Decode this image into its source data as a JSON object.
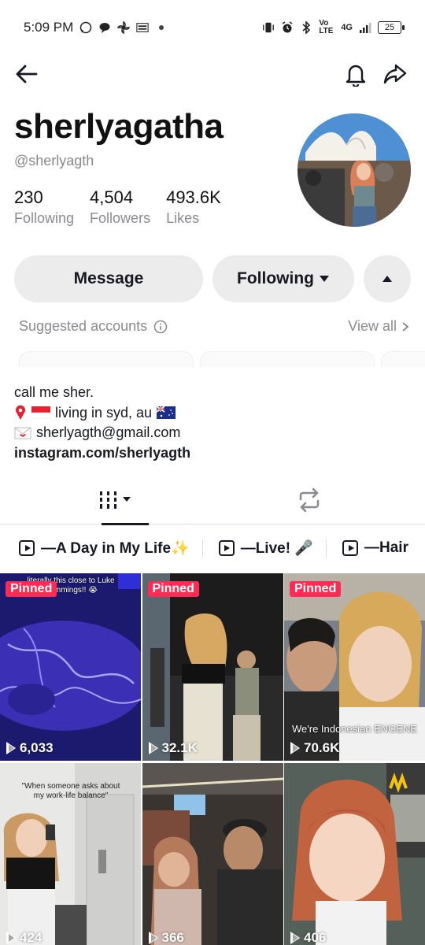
{
  "status_bar": {
    "time": "5:09 PM",
    "network": "Vo LTE",
    "signal": "4G",
    "battery": "25"
  },
  "profile": {
    "display_name": "sherlyagatha",
    "handle": "@sherlyagth",
    "stats": [
      {
        "value": "230",
        "label": "Following"
      },
      {
        "value": "4,504",
        "label": "Followers"
      },
      {
        "value": "493.6K",
        "label": "Likes"
      }
    ]
  },
  "actions": {
    "message_label": "Message",
    "following_label": "Following"
  },
  "suggested": {
    "label": "Suggested accounts",
    "view_all": "View all"
  },
  "bio": {
    "line1": "call me sher.",
    "line2": "living in syd, au",
    "email": "sherlyagth@gmail.com",
    "link": "instagram.com/sherlyagth"
  },
  "playlists": [
    {
      "label": "—A Day in My Life✨"
    },
    {
      "label": "—Live! 🎤"
    },
    {
      "label": "—Hair"
    }
  ],
  "videos": [
    {
      "pinned": "Pinned",
      "views": "6,033",
      "caption": "literally this close to Luke Hemmings!! 😭"
    },
    {
      "pinned": "Pinned",
      "views": "32.1K",
      "caption": ""
    },
    {
      "pinned": "Pinned",
      "views": "70.6K",
      "caption": "We're Indonesian ENGENE"
    },
    {
      "pinned": "",
      "views": "424",
      "caption": "\"When someone asks about my work-life balance\""
    },
    {
      "pinned": "",
      "views": "366",
      "caption": ""
    },
    {
      "pinned": "",
      "views": "406",
      "caption": ""
    }
  ],
  "colors": {
    "pinned_badge": "#fe2c55",
    "button_bg": "#ececec",
    "secondary_text": "#8a8b91"
  }
}
